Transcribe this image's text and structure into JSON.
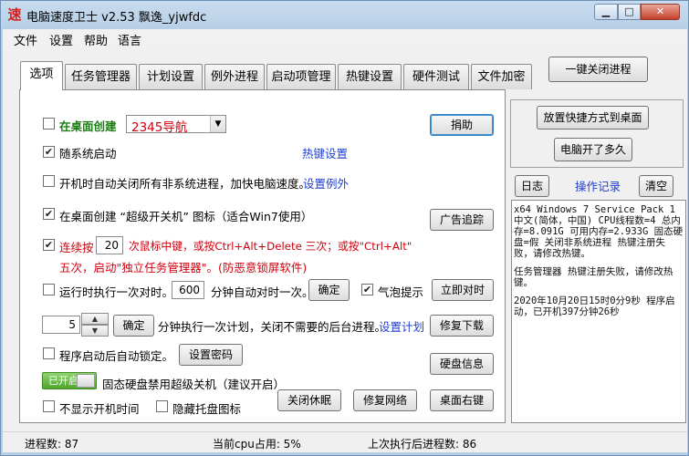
{
  "window": {
    "app_icon": "速",
    "title": "电脑速度卫士 v2.53  飘逸_yjwfdc",
    "buttons": {
      "minimize": "▁",
      "maximize": "□",
      "close": "✕"
    }
  },
  "menu": {
    "items": [
      "文件",
      "设置",
      "帮助",
      "语言"
    ]
  },
  "tabs": [
    "选项",
    "任务管理器",
    "计划设置",
    "例外进程",
    "启动项管理",
    "热键设置",
    "硬件测试",
    "文件加密"
  ],
  "top_button": "一键关闭进程",
  "panel": {
    "desktop_create_label": "在桌面创建",
    "desktop_combo_value": "2345导航",
    "donate_button": "捐助",
    "random_start_label": "随系统启动",
    "hotkey_link": "热键设置",
    "auto_close_label": "开机时自动关闭所有非系统进程，加快电脑速度。",
    "exception_link": "设置例外",
    "super_shutdown_label": "在桌面创建 “超级开关机” 图标（适合Win7使用）",
    "ad_trace_button": "广告追踪",
    "consecutive_prefix": "连续按",
    "consecutive_count": "20",
    "consecutive_suffix": "次鼠标中键，或按Ctrl+Alt+Delete 三次；或按\"Ctrl+Alt\"",
    "consecutive_line2": "五次，启动\"独立任务管理器\"。(防恶意锁屏软件)",
    "timesync_label": "运行时执行一次对时。",
    "timesync_minutes": "600",
    "timesync_suffix": "分钟自动对时一次。",
    "confirm_button": "确定",
    "bubble_label": "气泡提示",
    "sync_now_button": "立即对时",
    "plan_value": "5",
    "plan_confirm": "确定",
    "plan_text": "分钟执行一次计划，关闭不需要的后台进程。",
    "plan_link": "设置计划",
    "repair_download_button": "修复下载",
    "auto_lock_label": "程序启动后自动锁定。",
    "set_password_button": "设置密码",
    "disk_info_button": "硬盘信息",
    "toggle_label": "已开启",
    "ssd_label": "固态硬盘禁用超级关机（建议开启）",
    "no_boot_time_label": "不显示开机时间",
    "hide_tray_label": "隐藏托盘图标",
    "close_hibernate_button": "关闭休眠",
    "repair_network_button": "修复网络",
    "desktop_rightclick_button": "桌面右键"
  },
  "side": {
    "shortcut_button": "放置快捷方式到桌面",
    "uptime_button": "电脑开了多久",
    "log_button": "日志",
    "records_label": "操作记录",
    "clear_button": "清空",
    "log_lines": [
      "x64 Windows 7 Service Pack 1 中文(简体，中国) CPU线程数=4 总内存=8.091G 可用内存=2.933G 固态硬盘=假 关闭非系统进程 热键注册失败，请修改热键。",
      "任务管理器 热键注册失败，请修改热键。",
      " 2020年10月20日15时0分9秒 程序启动，已开机397分钟26秒"
    ]
  },
  "status": {
    "process_count": "进程数: 87",
    "cpu_usage": "当前cpu占用: 5%",
    "last_exec": "上次执行后进程数: 86"
  }
}
